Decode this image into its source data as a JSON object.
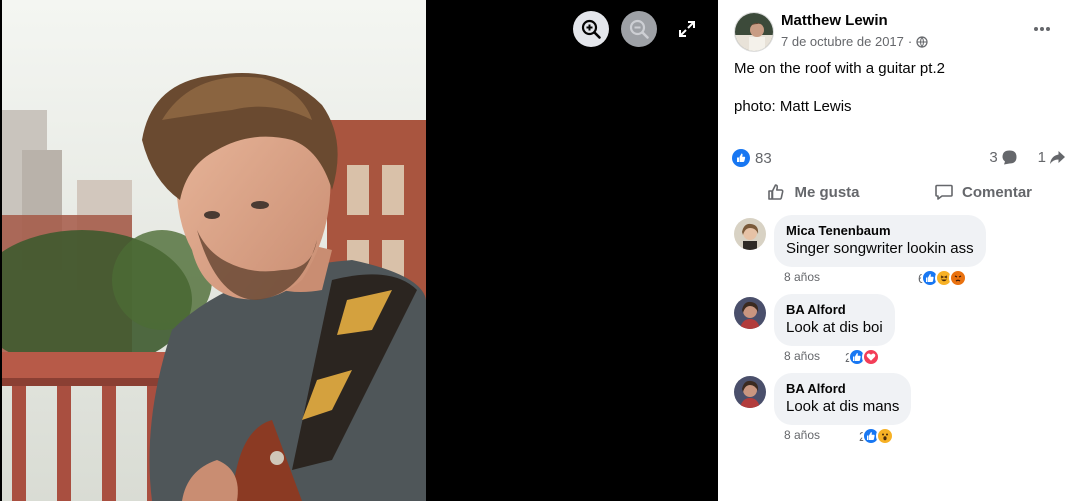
{
  "viewer": {
    "zoom_in_icon": "zoom-in-icon",
    "zoom_out_icon": "zoom-out-icon",
    "fullscreen_icon": "fullscreen-icon"
  },
  "post": {
    "author": "Matthew Lewin",
    "date": "7 de octubre de 2017",
    "separator": "·",
    "privacy_icon": "globe-icon",
    "caption": "Me on the roof with a guitar pt.2",
    "credit": "photo: Matt Lewis",
    "reaction_count": "83",
    "comment_count": "3",
    "share_count": "1"
  },
  "actions": {
    "like_label": "Me gusta",
    "comment_label": "Comentar"
  },
  "comments": [
    {
      "name": "Mica Tenenbaum",
      "text": "Singer songwriter lookin ass",
      "age": "8 años",
      "reaction_count": "6",
      "reactions": [
        "like",
        "haha",
        "angry"
      ]
    },
    {
      "name": "BA Alford",
      "text": "Look at dis boi",
      "age": "8 años",
      "reaction_count": "2",
      "reactions": [
        "like",
        "love"
      ]
    },
    {
      "name": "BA Alford",
      "text": "Look at dis mans",
      "age": "8 años",
      "reaction_count": "2",
      "reactions": [
        "like",
        "wow"
      ]
    }
  ],
  "colors": {
    "facebook_blue": "#1877f2",
    "love_red": "#f33e58",
    "haha_yellow": "#f7b125",
    "secondary_text": "#65676b",
    "bubble_bg": "#f0f2f5"
  }
}
